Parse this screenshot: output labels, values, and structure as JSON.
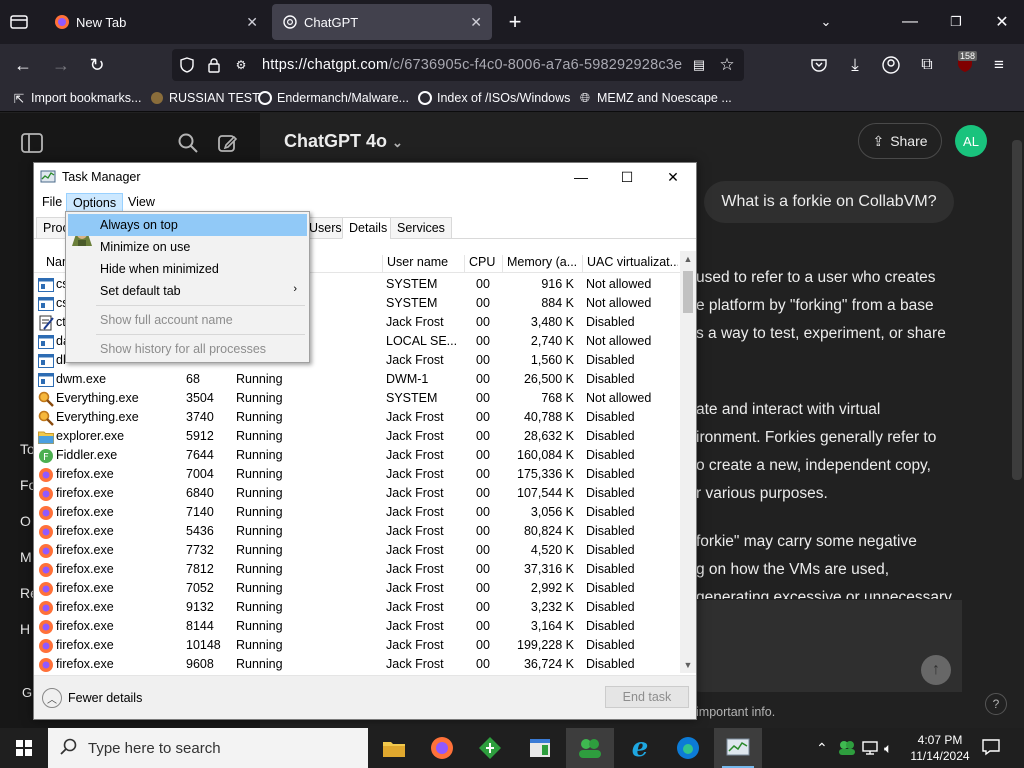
{
  "browser": {
    "tabs": [
      {
        "label": "New Tab",
        "active": false
      },
      {
        "label": "ChatGPT",
        "active": true
      }
    ],
    "url_host": "https://chatgpt.com",
    "url_path": "/c/6736905c-f4c0-8006-a7a6-598292928c3e",
    "extension_badge": "158",
    "bookmarks": [
      {
        "label": "Import bookmarks..."
      },
      {
        "label": "RUSSIAN TEST"
      },
      {
        "label": "Endermanch/Malware..."
      },
      {
        "label": "Index of /ISOs/Windows"
      },
      {
        "label": "MEMZ and Noescape ..."
      }
    ]
  },
  "chatgpt": {
    "model_title": "ChatGPT 4o",
    "share_label": "Share",
    "avatar_initials": "AL",
    "user_message": "What is a forkie on CollabVM?",
    "response_lines": [
      "used to refer to a user who creates",
      "e platform by \"forking\" from a base",
      "s a way to test, experiment, or share",
      "ate and interact with virtual",
      "ironment. Forkies generally refer to",
      "o create a new, independent copy,",
      "r various purposes.",
      "forkie\" may carry some negative",
      "g on how the VMs are used,",
      "generating excessive or unnecessary"
    ],
    "disclaimer": "important info.",
    "help": "?",
    "sidebar_fragments": [
      "To",
      "Fo",
      "O",
      "M",
      "Re",
      "H",
      "G"
    ]
  },
  "task_manager": {
    "title": "Task Manager",
    "menu": [
      "File",
      "Options",
      "View"
    ],
    "tabs": [
      "Proc",
      "Users",
      "Details",
      "Services"
    ],
    "active_tab": "Details",
    "columns": [
      "Name",
      "",
      "",
      "User name",
      "CPU",
      "Memory (a...",
      "UAC virtualizat..."
    ],
    "rows": [
      {
        "name": "cs",
        "pid": "",
        "status": "",
        "user": "SYSTEM",
        "cpu": "00",
        "mem": "916 K",
        "uac": "Not allowed",
        "icon": "exe"
      },
      {
        "name": "cs",
        "pid": "",
        "status": "",
        "user": "SYSTEM",
        "cpu": "00",
        "mem": "884 K",
        "uac": "Not allowed",
        "icon": "exe"
      },
      {
        "name": "ct",
        "pid": "",
        "status": "",
        "user": "Jack Frost",
        "cpu": "00",
        "mem": "3,480 K",
        "uac": "Disabled",
        "icon": "notepad"
      },
      {
        "name": "da",
        "pid": "",
        "status": "",
        "user": "LOCAL SE...",
        "cpu": "00",
        "mem": "2,740 K",
        "uac": "Not allowed",
        "icon": "exe"
      },
      {
        "name": "dl",
        "pid": "",
        "status": "",
        "user": "Jack Frost",
        "cpu": "00",
        "mem": "1,560 K",
        "uac": "Disabled",
        "icon": "exe"
      },
      {
        "name": "dwm.exe",
        "pid": "68",
        "status": "Running",
        "user": "DWM-1",
        "cpu": "00",
        "mem": "26,500 K",
        "uac": "Disabled",
        "icon": "exe"
      },
      {
        "name": "Everything.exe",
        "pid": "3504",
        "status": "Running",
        "user": "SYSTEM",
        "cpu": "00",
        "mem": "768 K",
        "uac": "Not allowed",
        "icon": "search"
      },
      {
        "name": "Everything.exe",
        "pid": "3740",
        "status": "Running",
        "user": "Jack Frost",
        "cpu": "00",
        "mem": "40,788 K",
        "uac": "Disabled",
        "icon": "search"
      },
      {
        "name": "explorer.exe",
        "pid": "5912",
        "status": "Running",
        "user": "Jack Frost",
        "cpu": "00",
        "mem": "28,632 K",
        "uac": "Disabled",
        "icon": "folder"
      },
      {
        "name": "Fiddler.exe",
        "pid": "7644",
        "status": "Running",
        "user": "Jack Frost",
        "cpu": "00",
        "mem": "160,084 K",
        "uac": "Disabled",
        "icon": "fiddler"
      },
      {
        "name": "firefox.exe",
        "pid": "7004",
        "status": "Running",
        "user": "Jack Frost",
        "cpu": "00",
        "mem": "175,336 K",
        "uac": "Disabled",
        "icon": "firefox"
      },
      {
        "name": "firefox.exe",
        "pid": "6840",
        "status": "Running",
        "user": "Jack Frost",
        "cpu": "00",
        "mem": "107,544 K",
        "uac": "Disabled",
        "icon": "firefox"
      },
      {
        "name": "firefox.exe",
        "pid": "7140",
        "status": "Running",
        "user": "Jack Frost",
        "cpu": "00",
        "mem": "3,056 K",
        "uac": "Disabled",
        "icon": "firefox"
      },
      {
        "name": "firefox.exe",
        "pid": "5436",
        "status": "Running",
        "user": "Jack Frost",
        "cpu": "00",
        "mem": "80,824 K",
        "uac": "Disabled",
        "icon": "firefox"
      },
      {
        "name": "firefox.exe",
        "pid": "7732",
        "status": "Running",
        "user": "Jack Frost",
        "cpu": "00",
        "mem": "4,520 K",
        "uac": "Disabled",
        "icon": "firefox"
      },
      {
        "name": "firefox.exe",
        "pid": "7812",
        "status": "Running",
        "user": "Jack Frost",
        "cpu": "00",
        "mem": "37,316 K",
        "uac": "Disabled",
        "icon": "firefox"
      },
      {
        "name": "firefox.exe",
        "pid": "7052",
        "status": "Running",
        "user": "Jack Frost",
        "cpu": "00",
        "mem": "2,992 K",
        "uac": "Disabled",
        "icon": "firefox"
      },
      {
        "name": "firefox.exe",
        "pid": "9132",
        "status": "Running",
        "user": "Jack Frost",
        "cpu": "00",
        "mem": "3,232 K",
        "uac": "Disabled",
        "icon": "firefox"
      },
      {
        "name": "firefox.exe",
        "pid": "8144",
        "status": "Running",
        "user": "Jack Frost",
        "cpu": "00",
        "mem": "3,164 K",
        "uac": "Disabled",
        "icon": "firefox"
      },
      {
        "name": "firefox.exe",
        "pid": "10148",
        "status": "Running",
        "user": "Jack Frost",
        "cpu": "00",
        "mem": "199,228 K",
        "uac": "Disabled",
        "icon": "firefox"
      },
      {
        "name": "firefox.exe",
        "pid": "9608",
        "status": "Running",
        "user": "Jack Frost",
        "cpu": "00",
        "mem": "36,724 K",
        "uac": "Disabled",
        "icon": "firefox"
      }
    ],
    "options_menu": [
      {
        "label": "Always on top",
        "state": "highlighted"
      },
      {
        "label": "Minimize on use",
        "state": "normal"
      },
      {
        "label": "Hide when minimized",
        "state": "normal"
      },
      {
        "label": "Set default tab",
        "state": "submenu"
      },
      {
        "label": "Show full account name",
        "state": "disabled"
      },
      {
        "label": "Show history for all processes",
        "state": "disabled"
      }
    ],
    "fewer_details": "Fewer details",
    "end_task": "End task"
  },
  "taskbar": {
    "search_placeholder": "Type here to search",
    "apps": [
      "file-explorer",
      "firefox",
      "app-green-diamond",
      "app-window",
      "app-users",
      "internet-explorer",
      "edge",
      "task-manager"
    ],
    "time": "4:07 PM",
    "date": "11/14/2024"
  },
  "colors": {
    "firefox_tabbar": "#1c1b22",
    "firefox_toolbar": "#2b2a33",
    "chatgpt_bg": "#212121",
    "avatar": "#19c37d",
    "menu_highlight": "#91c9f7"
  }
}
